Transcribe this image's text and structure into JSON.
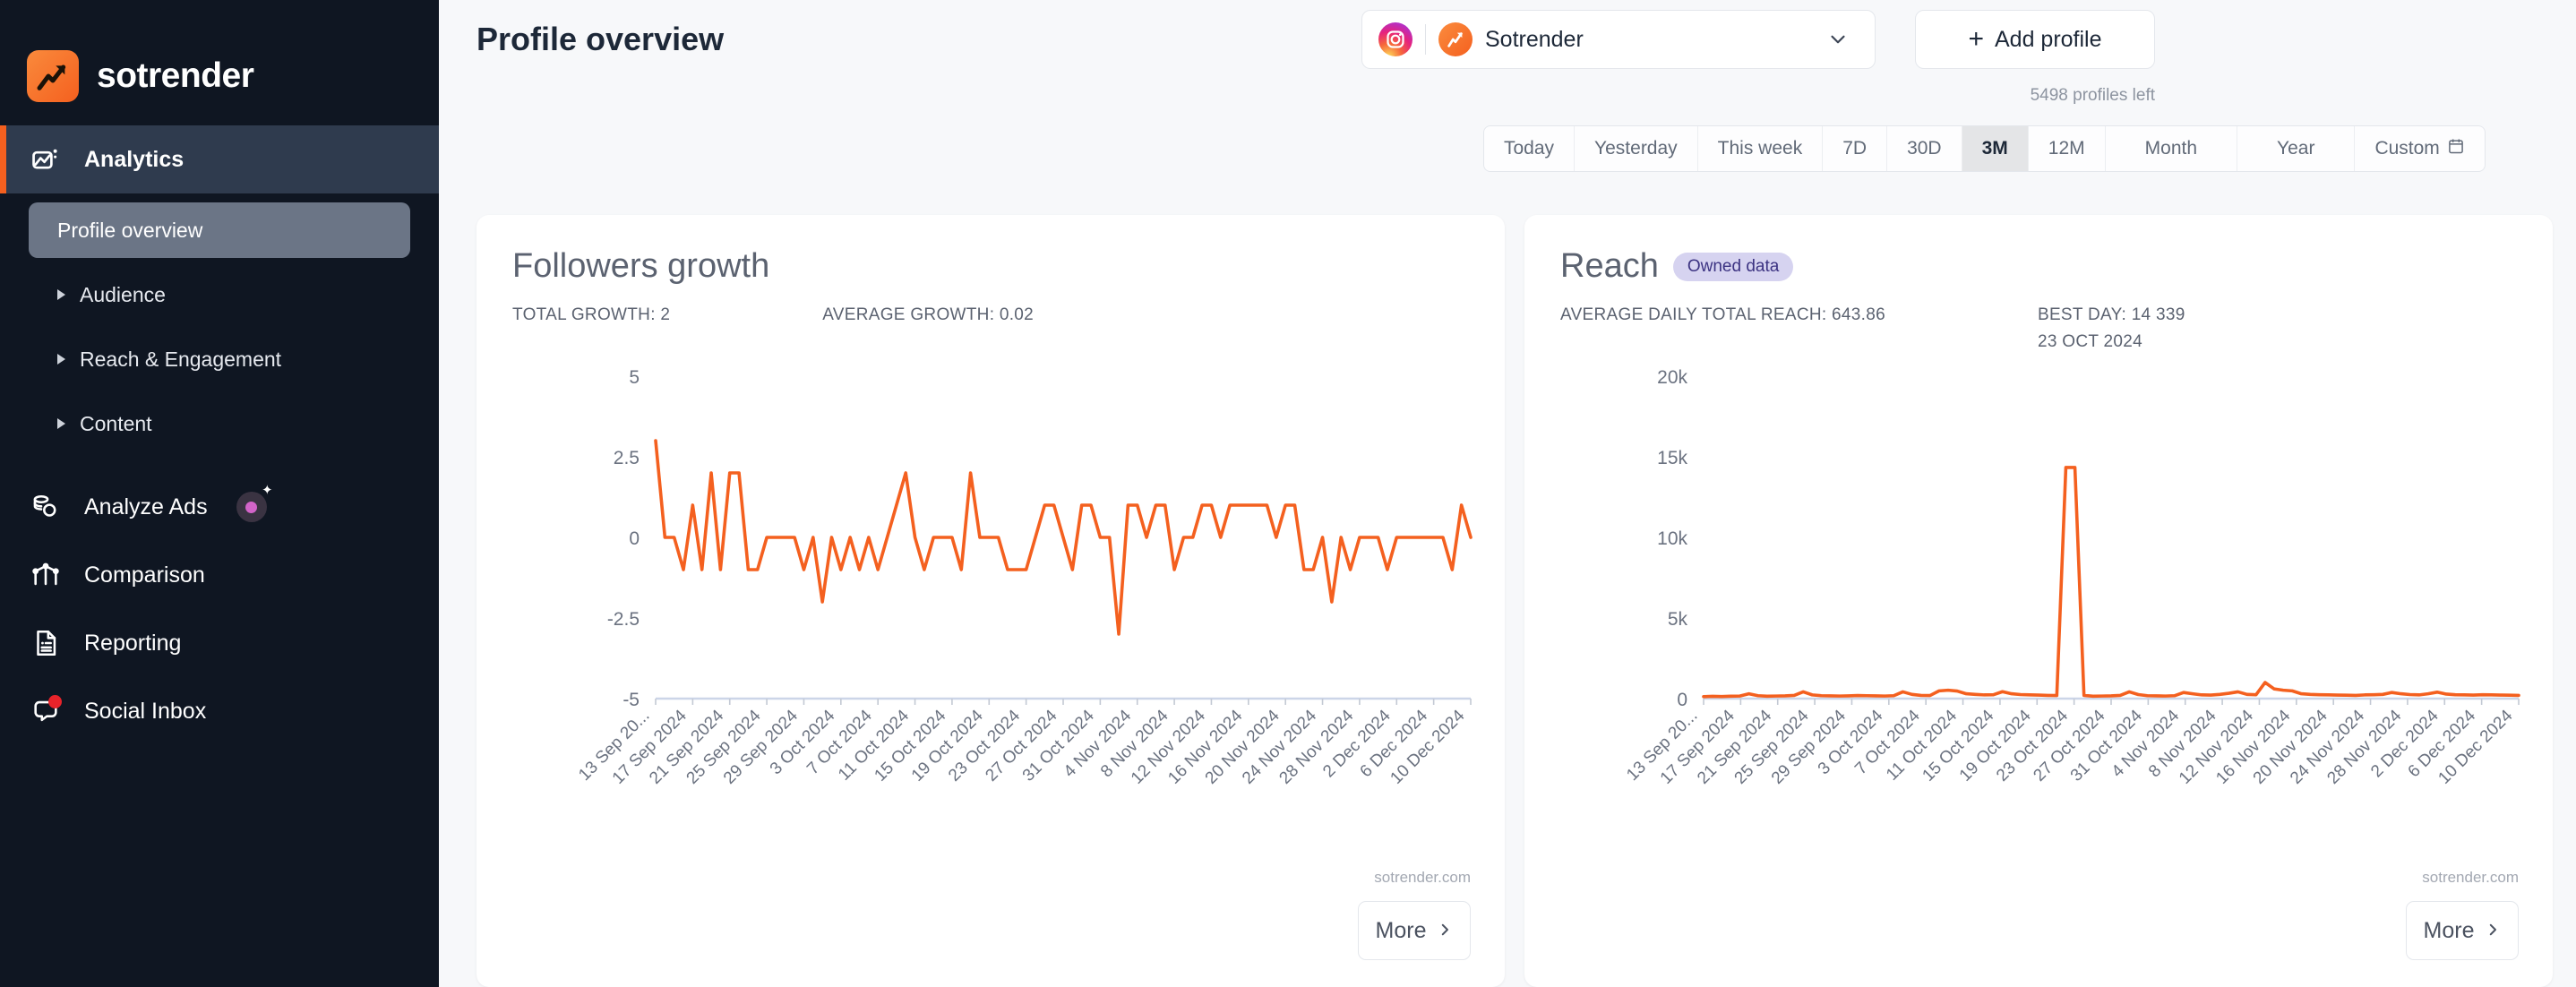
{
  "brand": {
    "name": "sotrender",
    "logo_icon": "trend-arrow-icon"
  },
  "sidebar": {
    "primary": {
      "label": "Analytics",
      "icon": "analytics-icon"
    },
    "sub_items": [
      {
        "label": "Profile overview",
        "selected": true
      },
      {
        "label": "Audience",
        "selected": false
      },
      {
        "label": "Reach & Engagement",
        "selected": false
      },
      {
        "label": "Content",
        "selected": false
      }
    ],
    "items": [
      {
        "label": "Analyze Ads",
        "icon": "coins-icon",
        "badge": "ai-sparkle-badge"
      },
      {
        "label": "Comparison",
        "icon": "comparison-chart-icon",
        "badge": null
      },
      {
        "label": "Reporting",
        "icon": "document-icon",
        "badge": null
      },
      {
        "label": "Social Inbox",
        "icon": "chat-bubble-icon",
        "badge": "notification-dot"
      }
    ]
  },
  "header": {
    "page_title": "Profile overview",
    "profile_selector": {
      "network_icon": "instagram-icon",
      "avatar_icon": "sotrender-avatar-icon",
      "name": "Sotrender",
      "chevron": "chevron-down-icon"
    },
    "add_profile_label": "Add profile",
    "add_profile_icon": "plus-icon",
    "profiles_left": "5498 profiles left"
  },
  "date_range": {
    "tabs": [
      {
        "label": "Today",
        "active": false
      },
      {
        "label": "Yesterday",
        "active": false
      },
      {
        "label": "This week",
        "active": false
      },
      {
        "label": "7D",
        "active": false
      },
      {
        "label": "30D",
        "active": false
      },
      {
        "label": "3M",
        "active": true
      },
      {
        "label": "12M",
        "active": false
      },
      {
        "label": "Month",
        "active": false
      },
      {
        "label": "Year",
        "active": false
      },
      {
        "label": "Custom",
        "active": false,
        "icon": "calendar-icon"
      }
    ]
  },
  "cards": [
    {
      "title": "Followers growth",
      "badge": null,
      "stat1": "TOTAL GROWTH: 2",
      "stat2": "AVERAGE GROWTH: 0.02",
      "stat2_sub": "",
      "watermark": "sotrender.com",
      "more_label": "More"
    },
    {
      "title": "Reach",
      "badge": "Owned data",
      "stat1": "AVERAGE DAILY TOTAL REACH: 643.86",
      "stat2": "BEST DAY: 14 339",
      "stat2_sub": "23 OCT 2024",
      "watermark": "sotrender.com",
      "more_label": "More"
    }
  ],
  "colors": {
    "line": "#f4601f",
    "sidebar_bg": "#0f1622",
    "accent": "#f4601f",
    "badge_bg": "#d6d3f0",
    "badge_fg": "#3c3382"
  },
  "chart_data": [
    {
      "type": "line",
      "title": "Followers growth",
      "xlabel": "",
      "ylabel": "",
      "ylim": [
        -5,
        5
      ],
      "yticks": [
        5,
        2.5,
        0,
        -2.5,
        -5
      ],
      "ytick_labels": [
        "5",
        "2.5",
        "0",
        "-2.5",
        "-5"
      ],
      "grid": false,
      "legend": "none",
      "xtick_labels": [
        "13 Sep 20...",
        "17 Sep 2024",
        "21 Sep 2024",
        "25 Sep 2024",
        "29 Sep 2024",
        "3 Oct 2024",
        "7 Oct 2024",
        "11 Oct 2024",
        "15 Oct 2024",
        "19 Oct 2024",
        "23 Oct 2024",
        "27 Oct 2024",
        "31 Oct 2024",
        "4 Nov 2024",
        "8 Nov 2024",
        "12 Nov 2024",
        "16 Nov 2024",
        "20 Nov 2024",
        "24 Nov 2024",
        "28 Nov 2024",
        "2 Dec 2024",
        "6 Dec 2024",
        "10 Dec 2024"
      ],
      "series": [
        {
          "name": "Followers growth",
          "color": "#f4601f",
          "values": [
            3,
            0,
            0,
            -1,
            1,
            -1,
            2,
            -1,
            2,
            2,
            -1,
            -1,
            0,
            0,
            0,
            0,
            -1,
            0,
            -2,
            0,
            -1,
            0,
            -1,
            0,
            -1,
            0,
            1,
            2,
            0,
            -1,
            0,
            0,
            0,
            -1,
            2,
            0,
            0,
            0,
            -1,
            -1,
            -1,
            0,
            1,
            1,
            0,
            -1,
            1,
            1,
            0,
            0,
            -3,
            1,
            1,
            0,
            1,
            1,
            -1,
            0,
            0,
            1,
            1,
            0,
            1,
            1,
            1,
            1,
            1,
            0,
            1,
            1,
            -1,
            -1,
            0,
            -2,
            0,
            -1,
            0,
            0,
            0,
            -1,
            0,
            0,
            0,
            0,
            0,
            0,
            -1,
            1,
            0
          ]
        }
      ]
    },
    {
      "type": "line",
      "title": "Reach",
      "xlabel": "",
      "ylabel": "",
      "ylim": [
        0,
        20000
      ],
      "yticks": [
        20000,
        15000,
        10000,
        5000,
        0
      ],
      "ytick_labels": [
        "20k",
        "15k",
        "10k",
        "5k",
        "0"
      ],
      "grid": false,
      "legend": "none",
      "best_day_value": 14339,
      "best_day_label": "23 OCT 2024",
      "average_daily_total_reach": 643.86,
      "xtick_labels": [
        "13 Sep 20...",
        "17 Sep 2024",
        "21 Sep 2024",
        "25 Sep 2024",
        "29 Sep 2024",
        "3 Oct 2024",
        "7 Oct 2024",
        "11 Oct 2024",
        "15 Oct 2024",
        "19 Oct 2024",
        "23 Oct 2024",
        "27 Oct 2024",
        "31 Oct 2024",
        "4 Nov 2024",
        "8 Nov 2024",
        "12 Nov 2024",
        "16 Nov 2024",
        "20 Nov 2024",
        "24 Nov 2024",
        "28 Nov 2024",
        "2 Dec 2024",
        "6 Dec 2024",
        "10 Dec 2024"
      ],
      "series": [
        {
          "name": "Total reach",
          "color": "#f4601f",
          "values": [
            120,
            140,
            130,
            150,
            160,
            300,
            180,
            150,
            160,
            170,
            200,
            420,
            230,
            180,
            170,
            160,
            170,
            190,
            180,
            170,
            160,
            180,
            420,
            260,
            200,
            190,
            480,
            520,
            470,
            300,
            260,
            230,
            240,
            430,
            300,
            250,
            230,
            220,
            200,
            190,
            14339,
            14339,
            200,
            150,
            160,
            170,
            200,
            420,
            250,
            180,
            170,
            160,
            180,
            380,
            300,
            230,
            220,
            260,
            330,
            420,
            260,
            240,
            1000,
            600,
            520,
            480,
            300,
            260,
            240,
            230,
            220,
            210,
            200,
            230,
            240,
            260,
            380,
            300,
            250,
            230,
            300,
            400,
            280,
            240,
            230,
            220,
            240,
            230,
            220,
            210,
            200
          ]
        }
      ]
    }
  ]
}
